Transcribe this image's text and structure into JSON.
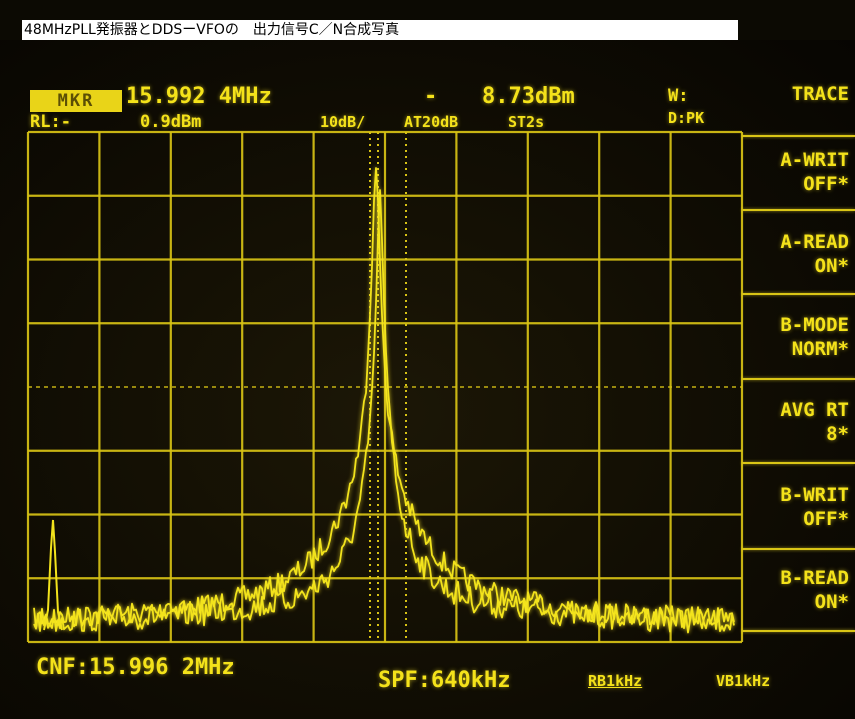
{
  "caption": "48MHzPLL発振器とDDSーVFOの　出力信号C／N合成写真",
  "header": {
    "mkr_label": "MKR",
    "mkr_freq": "15.992 4MHz",
    "mkr_dash": "-",
    "mkr_level": "8.73dBm",
    "window": "W:",
    "ref_level_label": "RL:-",
    "ref_level_value": "0.9dBm",
    "scale": "10dB/",
    "attenuation": "AT20dB",
    "sweep": "ST2s",
    "detector": "D:PK"
  },
  "footer": {
    "center_freq": "CNF:15.996 2MHz",
    "span": "SPF:640kHz",
    "rbw": "RB1kHz",
    "vbw": "VB1kHz"
  },
  "softkeys": [
    {
      "line1": "TRACE",
      "line2": ""
    },
    {
      "line1": "A-WRIT",
      "line2": "OFF*"
    },
    {
      "line1": "A-READ",
      "line2": "ON*"
    },
    {
      "line1": "B-MODE",
      "line2": "NORM*"
    },
    {
      "line1": "AVG RT",
      "line2": "8*"
    },
    {
      "line1": "B-WRIT",
      "line2": "OFF*"
    },
    {
      "line1": "B-READ",
      "line2": "ON*"
    }
  ],
  "colors": {
    "phosphor": "#f4e21a",
    "grid": "#d8c315",
    "trace": "#f2e31c",
    "background": "#0c0a03"
  }
}
